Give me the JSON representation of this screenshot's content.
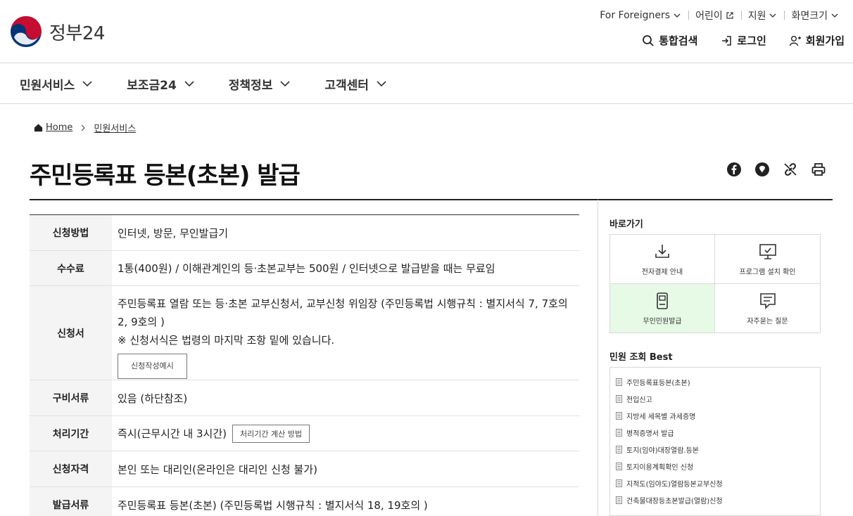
{
  "logo": {
    "text": "정부24"
  },
  "util": {
    "foreigners": "For Foreigners",
    "kids": "어린이",
    "support": "지원",
    "screen_size": "화면크기"
  },
  "mainlinks": {
    "search": "통합검색",
    "login": "로그인",
    "signup": "회원가입"
  },
  "nav": [
    "민원서비스",
    "보조금24",
    "정책정보",
    "고객센터"
  ],
  "breadcrumb": {
    "home": "Home",
    "current": "민원서비스"
  },
  "title": "주민등록표 등본(초본) 발급",
  "info": {
    "rows": [
      {
        "label": "신청방법",
        "value": "인터넷, 방문, 무인발급기"
      },
      {
        "label": "수수료",
        "value": "1통(400원) / 이해관계인의 등·초본교부는 500원 / 인터넷으로 발급받을 때는 무료임"
      },
      {
        "label": "신청서",
        "value": "주민등록표 열람 또는 등·초본 교부신청서, 교부신청 위임장 (주민등록법 시행규칙 : 별지서식 7, 7호의2, 9호의 )",
        "note": "※ 신청서식은 법령의 마지막 조항 밑에 있습니다.",
        "button": "신청작성예시"
      },
      {
        "label": "구비서류",
        "value": "있음 (하단참조)"
      },
      {
        "label": "처리기간",
        "value": "즉시(근무시간 내 3시간)",
        "button": "처리기간 계산 방법"
      },
      {
        "label": "신청자격",
        "value": "본인 또는 대리인(온라인은 대리인 신청 불가)"
      },
      {
        "label": "발급서류",
        "value": "주민등록표 등본(초본) (주민등록법 시행규칙 : 별지서식 18, 19호의 )"
      }
    ]
  },
  "side": {
    "quick_title": "바로가기",
    "quick": [
      {
        "label": "전자결제 안내",
        "icon": "download-icon"
      },
      {
        "label": "프로그램 설치 확인",
        "icon": "monitor-icon"
      },
      {
        "label": "무인민원발급",
        "icon": "kiosk-icon",
        "active": true
      },
      {
        "label": "자주묻는 질문",
        "icon": "chat-icon"
      }
    ],
    "best_title": "민원 조회 Best",
    "best": [
      "주민등록표등본(초본)",
      "전입신고",
      "지방세 세목별 과세증명",
      "병적증명서 발급",
      "토지(임야)대장열람.등본",
      "토지이용계획확인 신청",
      "지적도(임야도)열람등본교부신청",
      "건축물대장등초본발급(열람)신청"
    ]
  },
  "colors": {
    "quick_active_bg": "#e6fae6",
    "logo_red": "#c60c30",
    "logo_blue": "#003478"
  }
}
